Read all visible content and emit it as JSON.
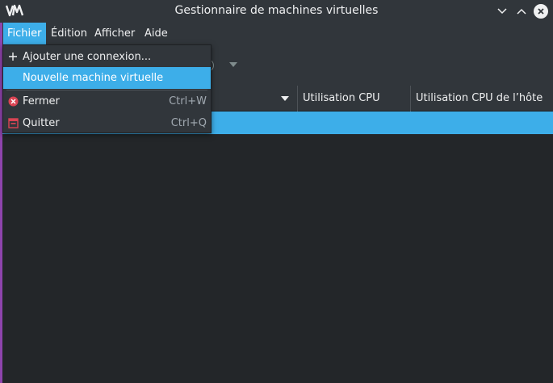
{
  "window": {
    "title": "Gestionnaire de machines virtuelles",
    "app_logo": "VM"
  },
  "menubar": {
    "items": [
      {
        "label": "Fichier",
        "active": true
      },
      {
        "label": "Édition"
      },
      {
        "label": "Afficher"
      },
      {
        "label": "Aide"
      }
    ]
  },
  "table": {
    "columns": [
      "Utilisation CPU",
      "Utilisation CPU de l’hôte"
    ]
  },
  "file_menu": {
    "items": [
      {
        "label": "Ajouter une connexion...",
        "icon": "plus-icon",
        "shortcut": ""
      },
      {
        "label": "Nouvelle machine virtuelle",
        "icon": "",
        "shortcut": "",
        "highlighted": true
      },
      {
        "label": "Fermer",
        "icon": "close-circle-icon",
        "shortcut": "Ctrl+W"
      },
      {
        "label": "Quitter",
        "icon": "quit-icon",
        "shortcut": "Ctrl+Q"
      }
    ]
  },
  "colors": {
    "accent": "#3daee9",
    "window_bg": "#31363b",
    "content_bg": "#232629",
    "close_icon_red": "#da4453",
    "side_accent": "#8e44ad"
  }
}
